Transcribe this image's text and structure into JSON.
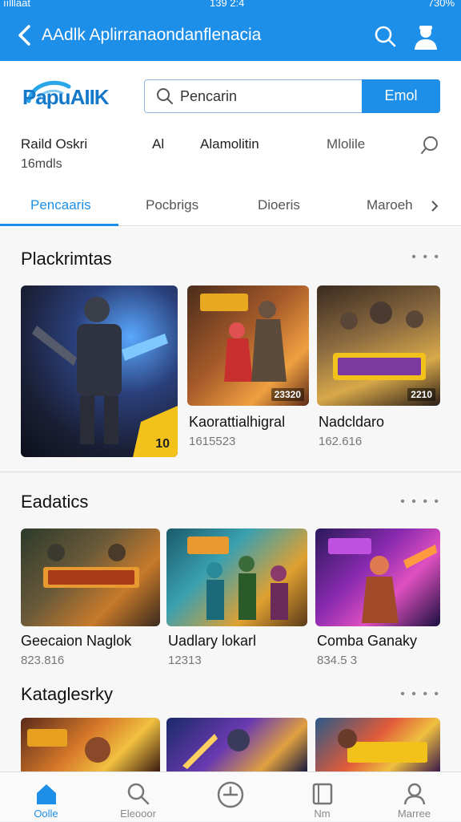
{
  "status": {
    "left": "ıılllaat",
    "time": "139 2:4",
    "battery": "730%"
  },
  "appbar": {
    "title": "AAdlk Aplirranaondanflenacia"
  },
  "brand": {
    "logo_text": "PapuAIIK"
  },
  "search": {
    "placeholder": "Pencarin",
    "value": "Pencarin",
    "button": "Emol"
  },
  "filters": {
    "items": [
      "Raild Oskri",
      "Al",
      "Alamolitin",
      "Mlolile"
    ],
    "sub": "16mdls"
  },
  "tabs": {
    "items": [
      "Pencaaris",
      "Pocbrigs",
      "Dioeris",
      "Maroeh"
    ],
    "active": 0
  },
  "sections": [
    {
      "title": "Plackrimtas",
      "more": "• • •",
      "cards": [
        {
          "name": "",
          "meta": "",
          "badge": "10"
        },
        {
          "name": "Kaorattialhigral",
          "meta": "1615523",
          "badge": "23320"
        },
        {
          "name": "Nadcldaro",
          "meta": "162.616",
          "badge": "2210"
        }
      ]
    },
    {
      "title": "Eadatics",
      "more": "• • • •",
      "cards": [
        {
          "name": "Geecaion Naglok",
          "meta": "823.816",
          "badge": ""
        },
        {
          "name": "Uadlary lokarl",
          "meta": "12313",
          "badge": ""
        },
        {
          "name": "Comba Ganaky",
          "meta": "834.5 3",
          "badge": ""
        }
      ]
    },
    {
      "title": "Kataglesrky",
      "more": "• • • •",
      "cards": [
        {
          "name": "",
          "meta": "",
          "badge": ""
        },
        {
          "name": "",
          "meta": "",
          "badge": ""
        },
        {
          "name": "",
          "meta": "",
          "badge": ""
        }
      ]
    }
  ],
  "bottom_nav": {
    "items": [
      {
        "label": "Oolle",
        "icon": "home-icon"
      },
      {
        "label": "Eleooor",
        "icon": "search-icon"
      },
      {
        "label": "",
        "icon": "clock-icon"
      },
      {
        "label": "Nm",
        "icon": "book-icon"
      },
      {
        "label": "Marree",
        "icon": "profile-icon"
      }
    ],
    "active": 0
  },
  "colors": {
    "primary": "#1e8fe8",
    "background": "#f2f3f5"
  }
}
